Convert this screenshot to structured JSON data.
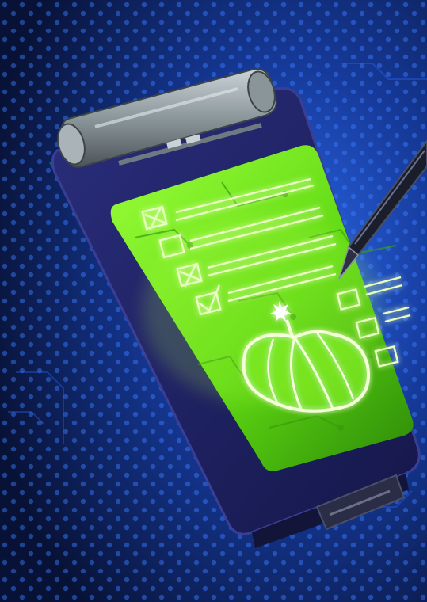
{
  "artwork": {
    "subject": "clipboard-tablet-icon",
    "colors": {
      "background_center": "#1f56d6",
      "background_edge": "#0a1642",
      "dots": "#3a7cff",
      "device_body": "#1b1d52",
      "device_edge": "#2a2f7a",
      "device_rim": "#0e6c7a",
      "clip_metal": "#8f9aa0",
      "screen_glow": "#7dff2a",
      "screen_dark": "#2f8a0c",
      "line_glow": "#c8ff6a",
      "pumpkin_outline": "#f4ffd8",
      "stylus": "#1a1d2a"
    },
    "checklist": {
      "checked_states": [
        "x",
        "empty",
        "x",
        "check",
        "empty",
        "empty",
        "empty"
      ]
    }
  }
}
